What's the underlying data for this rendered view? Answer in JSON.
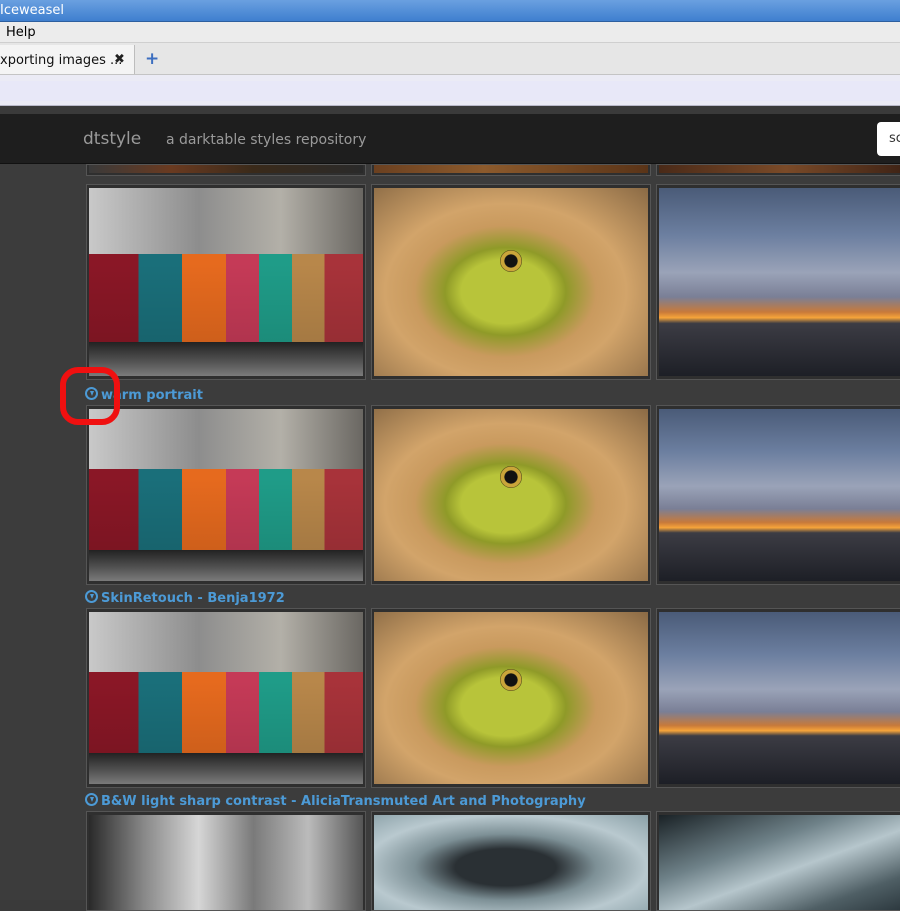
{
  "window": {
    "title": "Iceweasel"
  },
  "menu": {
    "help": "Help"
  },
  "tabs": [
    {
      "label": "xporting images ...",
      "close": "✖"
    }
  ],
  "new_tab": "+",
  "site": {
    "brand": "dtstyle",
    "tagline": "a darktable styles repository",
    "search_partial": "sc"
  },
  "styles": [
    {
      "title": "warm portrait"
    },
    {
      "title": "SkinRetouch - Benja1972"
    },
    {
      "title": "B&W light sharp contrast - AliciaTransmuted Art and Photography"
    }
  ],
  "colors": {
    "accent": "#4c9ad6",
    "highlight": "#f01010",
    "header_bg": "#1e1e1e"
  }
}
